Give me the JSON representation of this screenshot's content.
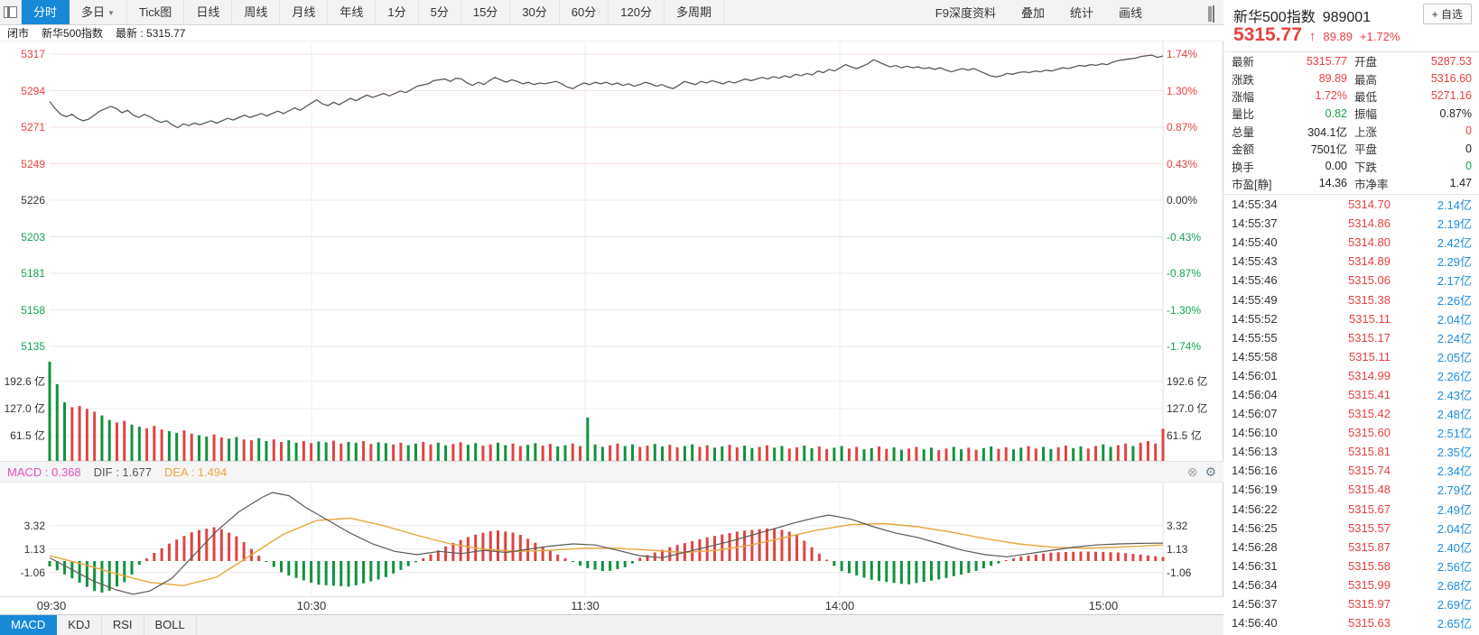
{
  "colors": {
    "up": "#e8413e",
    "down": "#12a351",
    "accent_blue": "#1789d7",
    "vol_text_blue": "#1b8de0",
    "bar_red": "#df4444",
    "bar_green": "#12923e",
    "price_line": "#5a5a5a",
    "dif_line": "#5a5a5a",
    "dea_line": "#e9a63c",
    "macd_label_pink": "#e750c0"
  },
  "toolbar": {
    "window_icon": "window-layout-icon",
    "tabs": [
      {
        "label": "分时",
        "active": true
      },
      {
        "label": "多日",
        "arrow": "▼"
      },
      {
        "label": "Tick图"
      },
      {
        "label": "日线"
      },
      {
        "label": "周线"
      },
      {
        "label": "月线"
      },
      {
        "label": "年线"
      },
      {
        "label": "1分"
      },
      {
        "label": "5分"
      },
      {
        "label": "15分"
      },
      {
        "label": "30分"
      },
      {
        "label": "60分"
      },
      {
        "label": "120分"
      },
      {
        "label": "多周期"
      }
    ],
    "right_links": [
      "F9深度资料",
      "叠加",
      "统计",
      "画线"
    ]
  },
  "subheader": {
    "market_status": "闭市",
    "name": "新华500指数",
    "latest": "最新 : 5315.77"
  },
  "indicator_tabs": [
    {
      "label": "MACD",
      "active": true
    },
    {
      "label": "KDJ"
    },
    {
      "label": "RSI"
    },
    {
      "label": "BOLL"
    }
  ],
  "chart_data": {
    "type": "line",
    "title": "新华500指数 分时走势",
    "x_ticks": [
      "09:30",
      "10:30",
      "11:30",
      "14:00",
      "15:00"
    ],
    "price_axis_labels": [
      "5317",
      "5294",
      "5271",
      "5249",
      "5226",
      "5203",
      "5181",
      "5158",
      "5135"
    ],
    "pct_axis_labels": [
      "1.74%",
      "1.30%",
      "0.87%",
      "0.43%",
      "0.00%",
      "-0.43%",
      "-0.87%",
      "-1.30%",
      "-1.74%"
    ],
    "volume_axis_labels": [
      "192.6 亿",
      "127.0 亿",
      "61.5 亿"
    ],
    "volume_axis_values": [
      192.6,
      127.0,
      61.5
    ],
    "macd_axis_labels": [
      "3.32",
      "1.13",
      "-1.06"
    ],
    "macd_axis_values": [
      3.32,
      1.13,
      -1.06
    ],
    "baseline_close": 5226.29,
    "price_ylim": [
      5135,
      5317
    ],
    "macd_labels": {
      "macd": "MACD : 0.368",
      "dif": "DIF : 1.677",
      "dea": "DEA : 1.494"
    },
    "macd_icons": [
      "close-icon",
      "gear-icon"
    ],
    "price_line": [
      0,
      5287.5,
      5,
      5283,
      10,
      5279.5,
      15,
      5278,
      20,
      5279.5,
      25,
      5277,
      30,
      5275.5,
      35,
      5276.5,
      45,
      5281.5,
      55,
      5284.5,
      60,
      5283,
      65,
      5280.5,
      70,
      5282,
      75,
      5279,
      80,
      5277.5,
      85,
      5279.5,
      90,
      5278,
      95,
      5276,
      100,
      5274.5,
      105,
      5275.5,
      110,
      5273,
      115,
      5271.2,
      120,
      5273.5,
      125,
      5272.5,
      130,
      5274,
      135,
      5273,
      145,
      5275.5,
      150,
      5274,
      160,
      5277,
      165,
      5276,
      175,
      5279,
      180,
      5277.5,
      190,
      5280,
      195,
      5278.5,
      205,
      5281.5,
      210,
      5280,
      220,
      5283.5,
      225,
      5282,
      235,
      5286.5,
      240,
      5288.5,
      245,
      5286,
      250,
      5285,
      255,
      5287,
      260,
      5285.5,
      270,
      5289.5,
      275,
      5288,
      285,
      5291.5,
      290,
      5290,
      300,
      5292.5,
      305,
      5291,
      315,
      5294,
      320,
      5293,
      330,
      5297,
      340,
      5298.5,
      345,
      5300.5,
      355,
      5301.5,
      360,
      5300,
      365,
      5302,
      370,
      5301.5,
      375,
      5299,
      380,
      5297.5,
      385,
      5299.5,
      390,
      5298,
      395,
      5300.5,
      400,
      5302.5,
      405,
      5301,
      410,
      5299.5,
      415,
      5301,
      420,
      5300,
      425,
      5298.5,
      430,
      5299.5,
      435,
      5298,
      440,
      5299,
      445,
      5298.5,
      455,
      5300,
      460,
      5298.5,
      465,
      5296.5,
      470,
      5295.5,
      475,
      5297.5,
      480,
      5299,
      485,
      5298,
      490,
      5299.5,
      495,
      5298.5,
      500,
      5299.5,
      505,
      5298,
      510,
      5299,
      515,
      5297.5,
      520,
      5298.5,
      525,
      5297,
      530,
      5298,
      535,
      5299.5,
      540,
      5298.5,
      545,
      5297,
      550,
      5298,
      555,
      5296.5,
      560,
      5295.5,
      565,
      5297.5,
      570,
      5300,
      575,
      5299,
      580,
      5298,
      585,
      5300,
      590,
      5299,
      595,
      5300.5,
      600,
      5299.5,
      605,
      5298.5,
      610,
      5300,
      615,
      5299,
      625,
      5301.5,
      630,
      5300.5,
      640,
      5302.5,
      645,
      5301.5,
      650,
      5303,
      655,
      5302,
      660,
      5303.5,
      665,
      5302.5,
      670,
      5304.5,
      675,
      5303.5,
      680,
      5305,
      685,
      5304,
      690,
      5306.5,
      695,
      5305.5,
      700,
      5307.5,
      705,
      5306.5,
      710,
      5308.5,
      715,
      5310.5,
      720,
      5309,
      725,
      5308,
      730,
      5309.5,
      735,
      5311,
      740,
      5313.5,
      745,
      5312,
      750,
      5310.5,
      755,
      5309,
      760,
      5310,
      765,
      5308.5,
      770,
      5309.5,
      775,
      5308.5,
      780,
      5309,
      785,
      5308,
      790,
      5308.5,
      795,
      5307.5,
      800,
      5308.5,
      805,
      5307,
      810,
      5306,
      815,
      5307,
      820,
      5308,
      825,
      5307,
      830,
      5308,
      835,
      5306.5,
      840,
      5305,
      845,
      5303.5,
      850,
      5302.8,
      855,
      5303.5,
      860,
      5305,
      865,
      5304.5,
      870,
      5305.5,
      875,
      5306,
      880,
      5305.5,
      885,
      5306.5,
      890,
      5306,
      895,
      5307,
      900,
      5306.5,
      905,
      5307.5,
      910,
      5308.5,
      915,
      5308,
      920,
      5309,
      925,
      5310,
      930,
      5309.5,
      935,
      5310.5,
      940,
      5310,
      945,
      5311,
      950,
      5310.5,
      955,
      5312,
      960,
      5313,
      965,
      5313.5,
      970,
      5314,
      975,
      5314.5,
      980,
      5315.5,
      985,
      5316,
      990,
      5316.3,
      995,
      5315,
      1000,
      5315.8
    ],
    "volume_bars": {
      "heights": [
        240,
        186,
        142,
        130,
        133,
        126,
        119,
        110,
        99,
        93,
        97,
        88,
        83,
        79,
        85,
        76,
        72,
        68,
        74,
        66,
        62,
        59,
        64,
        57,
        54,
        58,
        52,
        50,
        55,
        48,
        52,
        46,
        50,
        44,
        48,
        43,
        47,
        45,
        49,
        42,
        46,
        44,
        48,
        41,
        45,
        43,
        40,
        44,
        38,
        42,
        46,
        40,
        44,
        38,
        41,
        45,
        39,
        43,
        37,
        40,
        44,
        38,
        42,
        36,
        39,
        43,
        37,
        41,
        35,
        38,
        42,
        36,
        105,
        40,
        34,
        38,
        42,
        36,
        40,
        34,
        37,
        41,
        35,
        39,
        33,
        36,
        40,
        34,
        38,
        32,
        35,
        39,
        33,
        37,
        31,
        34,
        38,
        32,
        36,
        30,
        33,
        37,
        31,
        35,
        29,
        32,
        36,
        30,
        34,
        28,
        31,
        35,
        29,
        33,
        27,
        30,
        34,
        28,
        32,
        26,
        30,
        34,
        28,
        32,
        27,
        31,
        35,
        29,
        33,
        28,
        32,
        36,
        30,
        34,
        29,
        33,
        37,
        31,
        35,
        30,
        36,
        40,
        34,
        38,
        42,
        36,
        44,
        48,
        42,
        78
      ],
      "colors": "gggrrrrggrrggrrrggrrggrrggrrggrrggrrggrrggrrggrrggrrggrrggrrggrrggrrggrrgggrrggrrggrrggrrggrrggrrggrrggrrggrrggrrggrrggrrggrrggrrggrrggrrggrrggrrg"
    },
    "macd": {
      "dif": [
        0,
        0.3,
        20,
        -0.8,
        40,
        -1.9,
        60,
        -2.7,
        75,
        -3.1,
        90,
        -2.8,
        110,
        -1.6,
        130,
        0.6,
        150,
        2.8,
        170,
        4.6,
        190,
        5.9,
        200,
        6.4,
        215,
        6.1,
        230,
        5.0,
        250,
        3.8,
        270,
        2.6,
        290,
        1.6,
        310,
        0.9,
        330,
        0.6,
        350,
        0.9,
        370,
        0.7,
        390,
        1.0,
        410,
        0.8,
        430,
        1.1,
        450,
        1.4,
        470,
        1.6,
        490,
        1.5,
        510,
        1.0,
        530,
        0.5,
        550,
        0.3,
        570,
        0.8,
        590,
        1.3,
        610,
        1.8,
        630,
        2.4,
        650,
        3.0,
        670,
        3.6,
        690,
        4.1,
        700,
        4.3,
        720,
        3.9,
        740,
        3.2,
        760,
        2.6,
        780,
        2.2,
        800,
        1.6,
        820,
        1.0,
        840,
        0.6,
        860,
        0.4,
        880,
        0.7,
        900,
        1.0,
        920,
        1.3,
        940,
        1.5,
        960,
        1.6,
        980,
        1.65,
        1000,
        1.677
      ],
      "dea": [
        0,
        0.5,
        30,
        -0.3,
        60,
        -1.2,
        90,
        -2.0,
        120,
        -2.3,
        150,
        -1.5,
        180,
        0.5,
        210,
        2.5,
        240,
        3.8,
        270,
        4.0,
        300,
        3.3,
        330,
        2.4,
        360,
        1.6,
        390,
        1.1,
        420,
        0.9,
        450,
        1.0,
        480,
        1.2,
        510,
        1.2,
        540,
        1.0,
        570,
        0.8,
        600,
        1.0,
        630,
        1.5,
        660,
        2.2,
        690,
        2.9,
        720,
        3.4,
        750,
        3.5,
        780,
        3.2,
        810,
        2.7,
        840,
        2.1,
        870,
        1.6,
        900,
        1.3,
        930,
        1.2,
        960,
        1.3,
        990,
        1.45,
        1000,
        1.494
      ],
      "hist": [
        0,
        -0.5,
        20,
        -1.6,
        40,
        -2.8,
        50,
        -3.0,
        70,
        -1.8,
        80,
        -0.4,
        90,
        0.5,
        110,
        1.8,
        130,
        2.8,
        150,
        3.2,
        170,
        2.2,
        190,
        0.3,
        210,
        -1.2,
        240,
        -2.2,
        270,
        -2.4,
        300,
        -1.6,
        320,
        -0.6,
        340,
        0.5,
        360,
        1.6,
        380,
        2.4,
        400,
        2.9,
        420,
        2.6,
        440,
        1.5,
        460,
        0.4,
        480,
        -0.6,
        500,
        -1.0,
        520,
        -0.5,
        530,
        0.3,
        560,
        1.4,
        590,
        2.2,
        620,
        2.8,
        650,
        3.1,
        670,
        2.6,
        690,
        0.8,
        710,
        -0.9,
        740,
        -1.8,
        770,
        -2.2,
        800,
        -1.7,
        830,
        -1.0,
        850,
        -0.3,
        870,
        0.4,
        900,
        0.8,
        930,
        0.9,
        960,
        0.8,
        980,
        0.6,
        1000,
        0.37
      ]
    }
  },
  "side_panel": {
    "name": "新华500指数",
    "code": "989001",
    "watch_button": "+ 自选",
    "price": "5315.77",
    "arrow": "↑",
    "change": "89.89",
    "change_pct": "+1.72%",
    "quote_rows": [
      {
        "l1": "最新",
        "v1": "5315.77",
        "c1": "up",
        "l2": "开盘",
        "v2": "5287.53",
        "c2": "up"
      },
      {
        "l1": "涨跌",
        "v1": "89.89",
        "c1": "up",
        "l2": "最高",
        "v2": "5316.60",
        "c2": "up"
      },
      {
        "l1": "涨幅",
        "v1": "1.72%",
        "c1": "up",
        "l2": "最低",
        "v2": "5271.16",
        "c2": "up"
      },
      {
        "l1": "量比",
        "v1": "0.82",
        "c1": "down",
        "l2": "振幅",
        "v2": "0.87%",
        "c2": "flat"
      },
      {
        "l1": "总量",
        "v1": "304.1亿",
        "c1": "flat",
        "l2": "上涨",
        "v2": "0",
        "c2": "up"
      },
      {
        "l1": "金额",
        "v1": "7501亿",
        "c1": "flat",
        "l2": "平盘",
        "v2": "0",
        "c2": "flat"
      },
      {
        "l1": "换手",
        "v1": "0.00",
        "c1": "flat",
        "l2": "下跌",
        "v2": "0",
        "c2": "down"
      },
      {
        "l1": "市盈[静]",
        "v1": "14.36",
        "c1": "flat",
        "l2": "市净率",
        "v2": "1.47",
        "c2": "flat"
      }
    ],
    "ticks": [
      {
        "time": "14:55:34",
        "price": "5314.70",
        "vol": "2.14亿"
      },
      {
        "time": "14:55:37",
        "price": "5314.86",
        "vol": "2.19亿"
      },
      {
        "time": "14:55:40",
        "price": "5314.80",
        "vol": "2.42亿"
      },
      {
        "time": "14:55:43",
        "price": "5314.89",
        "vol": "2.29亿"
      },
      {
        "time": "14:55:46",
        "price": "5315.06",
        "vol": "2.17亿"
      },
      {
        "time": "14:55:49",
        "price": "5315.38",
        "vol": "2.26亿"
      },
      {
        "time": "14:55:52",
        "price": "5315.11",
        "vol": "2.04亿"
      },
      {
        "time": "14:55:55",
        "price": "5315.17",
        "vol": "2.24亿"
      },
      {
        "time": "14:55:58",
        "price": "5315.11",
        "vol": "2.05亿"
      },
      {
        "time": "14:56:01",
        "price": "5314.99",
        "vol": "2.26亿"
      },
      {
        "time": "14:56:04",
        "price": "5315.41",
        "vol": "2.43亿"
      },
      {
        "time": "14:56:07",
        "price": "5315.42",
        "vol": "2.48亿"
      },
      {
        "time": "14:56:10",
        "price": "5315.60",
        "vol": "2.51亿"
      },
      {
        "time": "14:56:13",
        "price": "5315.81",
        "vol": "2.35亿"
      },
      {
        "time": "14:56:16",
        "price": "5315.74",
        "vol": "2.34亿"
      },
      {
        "time": "14:56:19",
        "price": "5315.48",
        "vol": "2.79亿"
      },
      {
        "time": "14:56:22",
        "price": "5315.67",
        "vol": "2.49亿"
      },
      {
        "time": "14:56:25",
        "price": "5315.57",
        "vol": "2.04亿"
      },
      {
        "time": "14:56:28",
        "price": "5315.87",
        "vol": "2.40亿"
      },
      {
        "time": "14:56:31",
        "price": "5315.58",
        "vol": "2.56亿"
      },
      {
        "time": "14:56:34",
        "price": "5315.99",
        "vol": "2.68亿"
      },
      {
        "time": "14:56:37",
        "price": "5315.97",
        "vol": "2.69亿"
      },
      {
        "time": "14:56:40",
        "price": "5315.63",
        "vol": "2.65亿"
      }
    ]
  }
}
